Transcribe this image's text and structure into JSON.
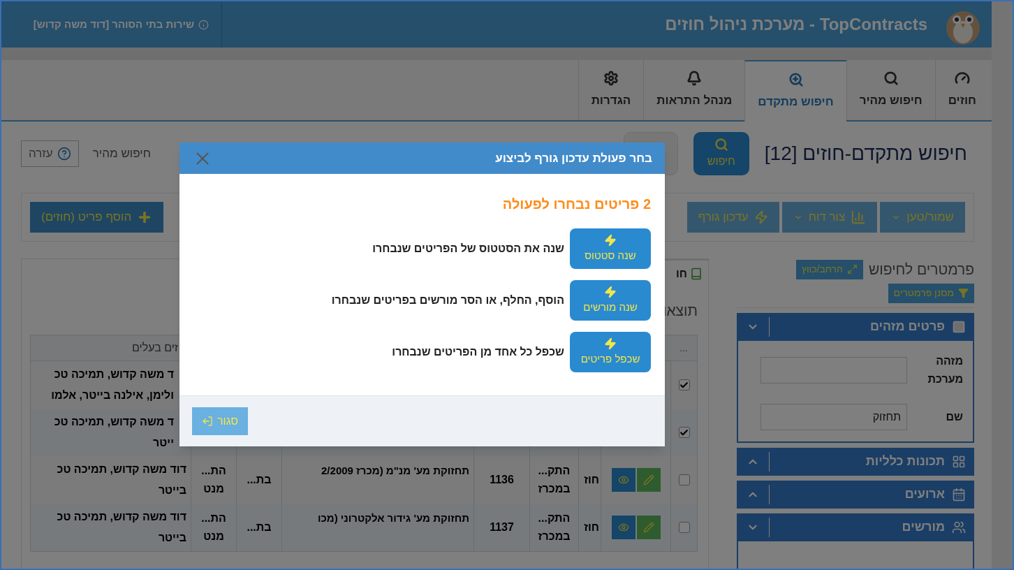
{
  "header": {
    "title": "TopContracts - מערכת ניהול חוזים",
    "user": "שירות בתי הסוהר [דוד משה קדוש]"
  },
  "nav_tabs": [
    {
      "label": "חוזים",
      "kind": "dashboard",
      "selected": false
    },
    {
      "label": "חיפוש מהיר",
      "kind": "search",
      "selected": false
    },
    {
      "label": "חיפוש מתקדם",
      "kind": "zoom",
      "selected": true
    },
    {
      "label": "מנהל התראות",
      "kind": "bell",
      "selected": false
    },
    {
      "label": "הגדרות",
      "kind": "gear",
      "selected": false
    }
  ],
  "search_header": {
    "title": "חיפוש מתקדם-חוזים [12]",
    "search_button": "חיפוש",
    "quick_search": "חיפוש מהיר",
    "help_button": "עזרה"
  },
  "toolbar": {
    "buttons": [
      {
        "label": "שמור/טען",
        "kind": "dropdown"
      },
      {
        "label": "צור דוח",
        "kind": "report"
      },
      {
        "label": "עדכון גורף",
        "kind": "bulk"
      }
    ],
    "add_button": "הוסף פריט (חוזים)"
  },
  "params": {
    "title": "פרמטרים לחיפוש",
    "toggle_button": "הרחב/כווץ",
    "filter_button": "מסנן פרמטרים",
    "sections": [
      {
        "title": "פרטים מזהים",
        "kind": "identity",
        "expanded": true,
        "fields": [
          {
            "label": "מזהה מערכת"
          },
          {
            "label": "שם",
            "value": "תחזוק"
          }
        ]
      },
      {
        "title": "תכונות כלליות",
        "kind": "general",
        "expanded": false
      },
      {
        "title": "ארועים",
        "kind": "events",
        "expanded": false
      },
      {
        "title": "מורשים",
        "kind": "users",
        "expanded": true
      }
    ]
  },
  "results": {
    "tab": "חו",
    "subtitle": "תוצאו",
    "select_header": "...",
    "owners_header": "זים בעלים",
    "rows": [
      {
        "checked": true,
        "owners": [
          "ד משה קדוש, תמיכה טכ",
          "ולימן, אילנה בייטר, אלמו"
        ]
      },
      {
        "checked": true,
        "owners": [
          "ד משה קדוש, תמיכה טכ",
          "ייטר"
        ]
      },
      {
        "checked": false,
        "type": "חוז",
        "status": [
          "התק...",
          "במכרז"
        ],
        "number": "1136",
        "name": "תחזוקת מע' מנ\"מ (מכרז 2/2009",
        "col_a": "בת...",
        "col_b": [
          "הת...",
          "מנט"
        ],
        "owners": [
          "דוד משה קדוש, תמיכה טכ",
          "בייטר"
        ]
      },
      {
        "checked": false,
        "type": "חוז",
        "status": [
          "התק...",
          "במכרז"
        ],
        "number": "1137",
        "name": "תחזוקת מע' גידור אלקטרוני (מכו",
        "col_a": "בת...",
        "col_b": [
          "הת...",
          "מנט"
        ],
        "owners": [
          "דוד משה קדוש, תמיכה טכ",
          "בייטר"
        ]
      }
    ]
  },
  "dialog": {
    "title": "בחר פעולת עדכון גורף לביצוע",
    "heading": "2 פריטים נבחרו לפעולה",
    "actions": [
      {
        "label": "שנה סטטוס",
        "description": "שנה את הסטטוס של הפריטים שנבחרו"
      },
      {
        "label": "שנה מורשים",
        "description": "הוסף, החלף, או הסר מורשים בפריטים שנבחרו"
      },
      {
        "label": "שכפל פריטים",
        "description": "שכפל כל אחד מן הפריטים שנבחרו"
      }
    ],
    "close_button": "סגור"
  }
}
